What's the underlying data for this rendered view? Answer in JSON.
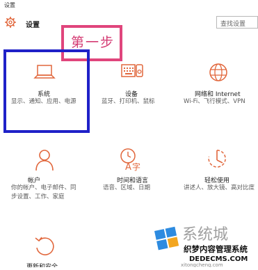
{
  "window": {
    "title": "设置"
  },
  "header": {
    "title": "设置",
    "search_placeholder": "查找设置"
  },
  "annotation": {
    "step_label": "第一步"
  },
  "tiles": [
    {
      "title": "系统",
      "description": "显示、通知、应用、电源",
      "icon": "laptop-icon"
    },
    {
      "title": "设备",
      "description": "蓝牙、打印机、鼠标",
      "icon": "devices-icon"
    },
    {
      "title": "网络和 Internet",
      "description": "Wi-Fi、飞行模式、VPN",
      "icon": "globe-icon"
    },
    {
      "title": "帐户",
      "description": "你的帐户、电子邮件、同步设置、工作、家庭",
      "icon": "person-icon"
    },
    {
      "title": "时间和语言",
      "description": "语音、区域、日期",
      "icon": "time-language-icon"
    },
    {
      "title": "轻松使用",
      "description": "讲述人、放大镜、高对比度",
      "icon": "ease-of-access-icon"
    },
    {
      "title": "更新和安全",
      "description": "",
      "icon": "update-icon"
    }
  ],
  "watermark": {
    "brand": "系统城",
    "tagline": "织梦内容管理系统",
    "site": "DEDECMS.COM",
    "url": "xitongcheng.com"
  },
  "colors": {
    "accent": "#e1663b",
    "step_outline": "#e0457c",
    "highlight_outline": "#1f21c8"
  }
}
